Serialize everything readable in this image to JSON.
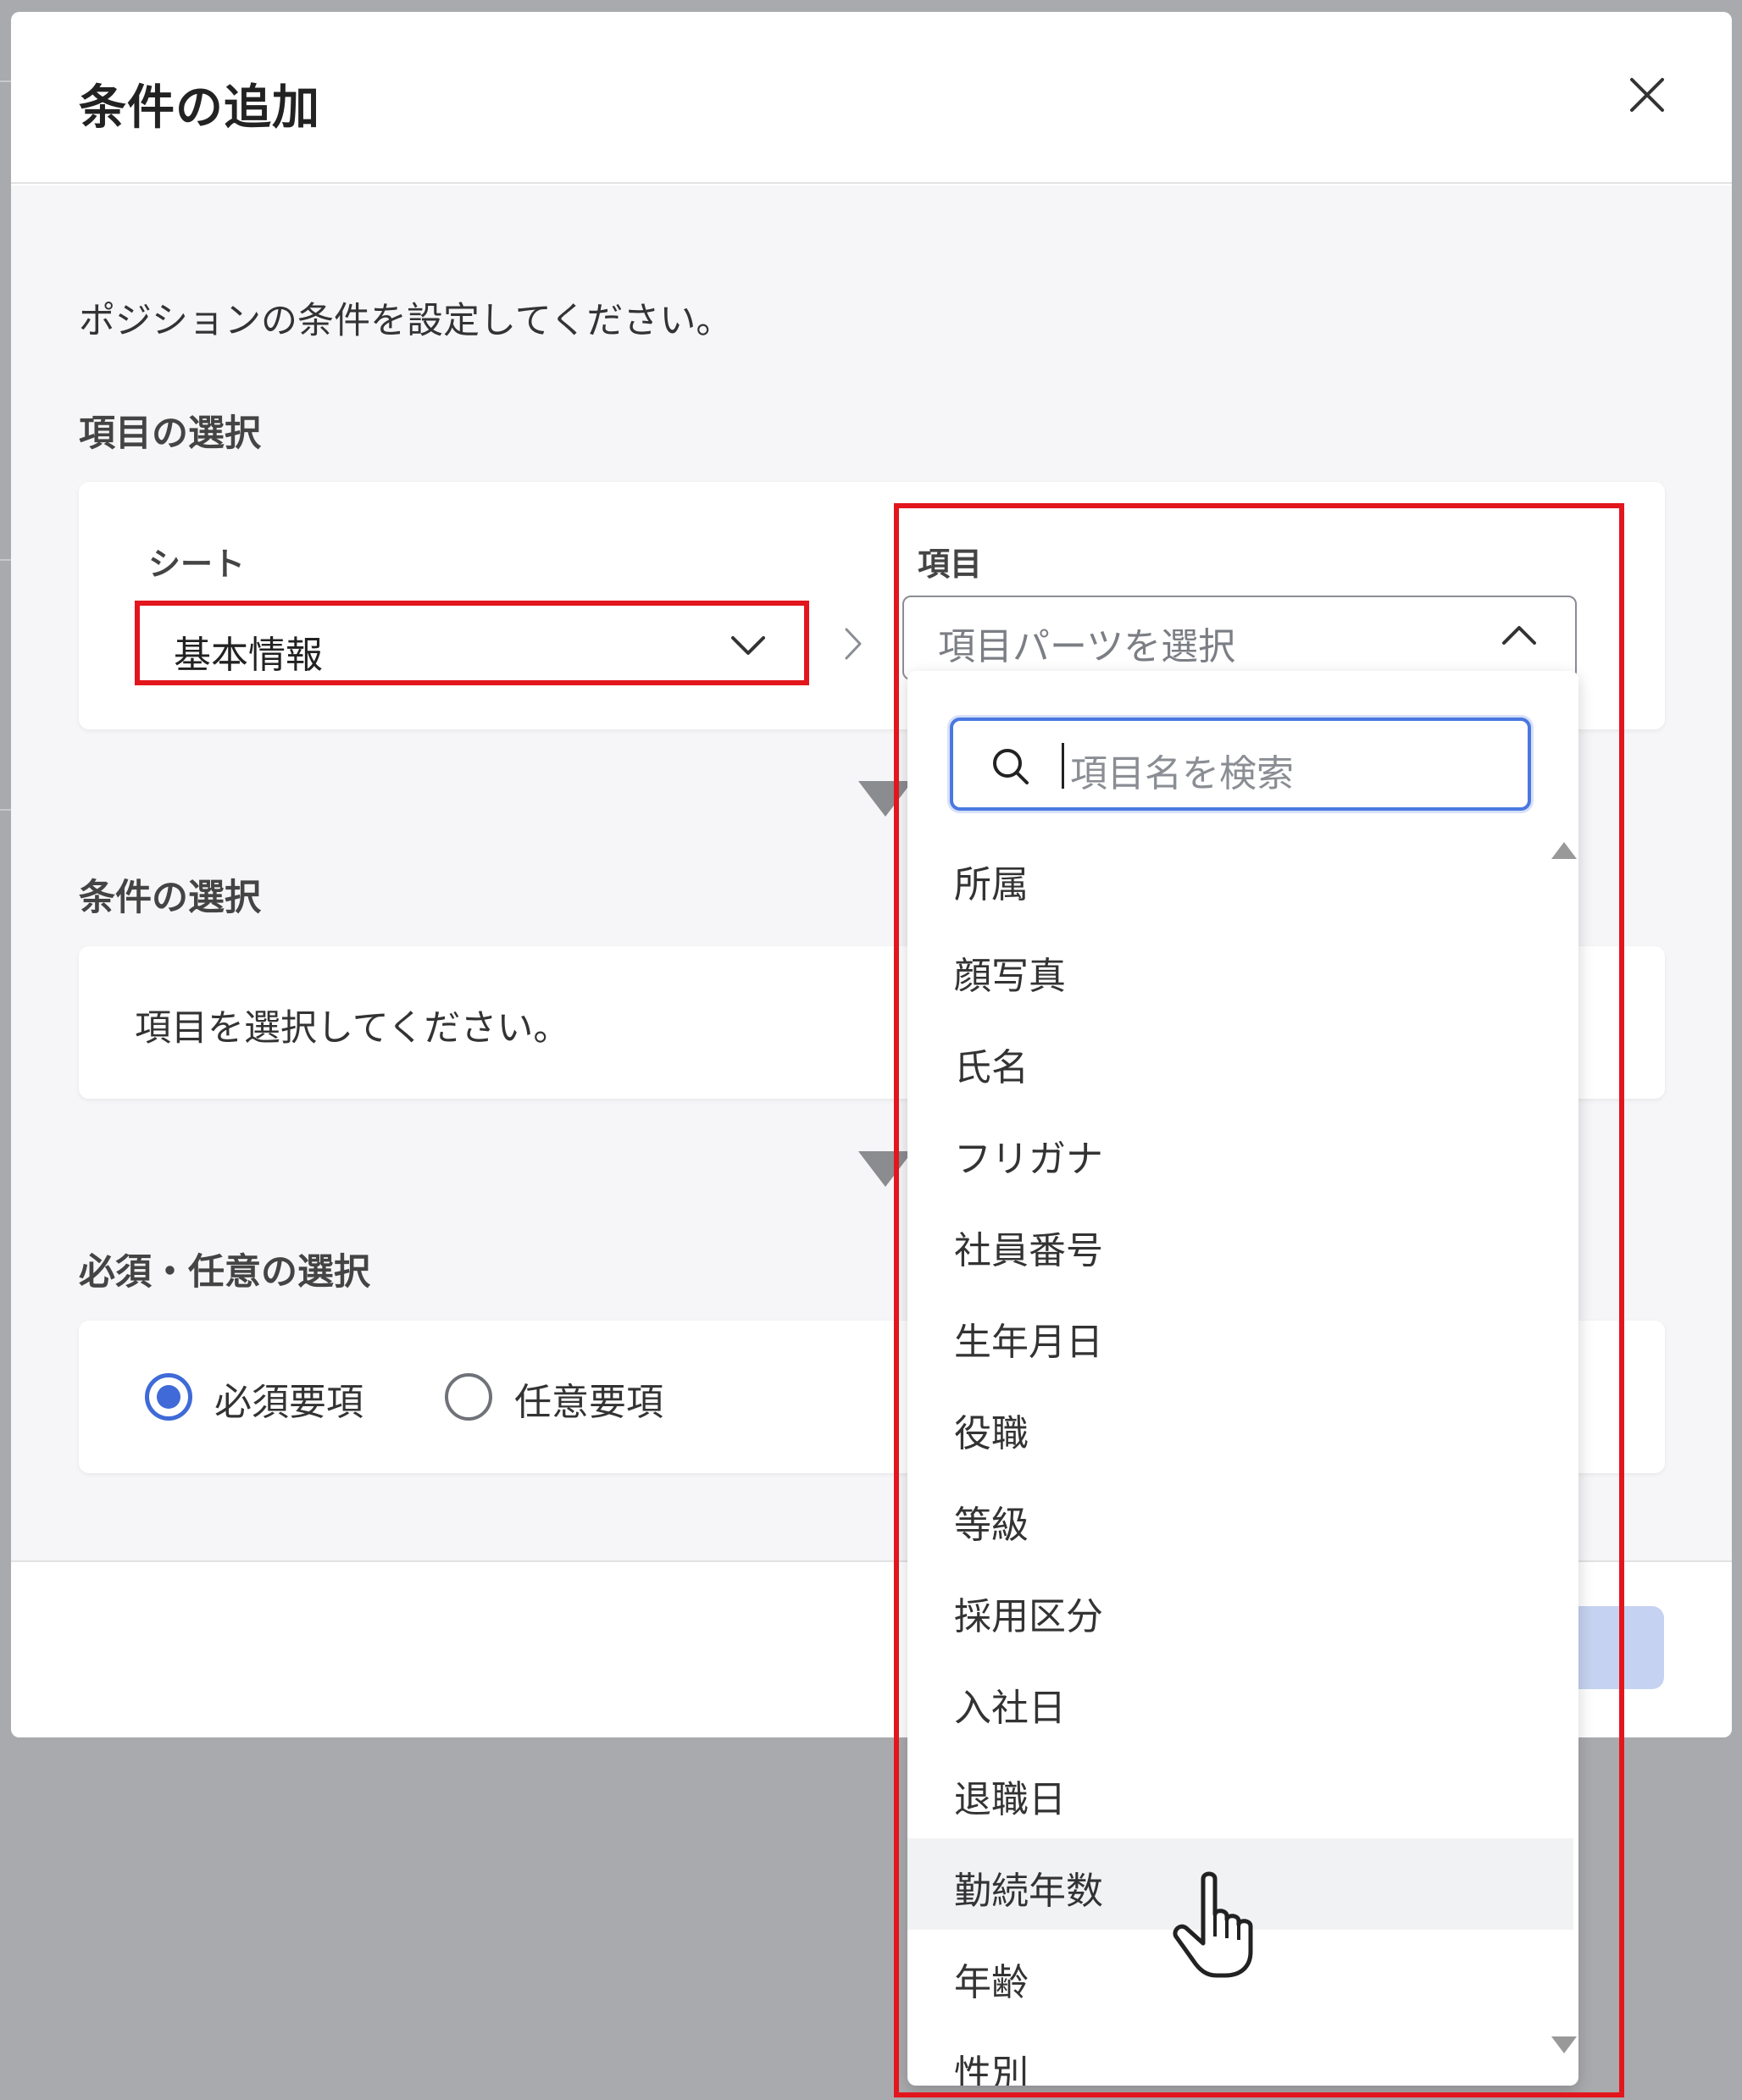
{
  "dialog": {
    "title": "条件の追加",
    "description": "ポジションの条件を設定してください。"
  },
  "item_selection": {
    "section_title": "項目の選択",
    "sheet_label": "シート",
    "sheet_value": "基本情報",
    "item_label": "項目",
    "item_placeholder": "項目パーツを選択"
  },
  "condition_selection": {
    "section_title": "条件の選択",
    "message": "項目を選択してください。"
  },
  "required_selection": {
    "section_title": "必須・任意の選択",
    "options": [
      {
        "label": "必須要項",
        "selected": true
      },
      {
        "label": "任意要項",
        "selected": false
      }
    ]
  },
  "dropdown": {
    "search_placeholder": "項目名を検索",
    "items": [
      "所属",
      "顔写真",
      "氏名",
      "フリガナ",
      "社員番号",
      "生年月日",
      "役職",
      "等級",
      "採用区分",
      "入社日",
      "退職日",
      "勤続年数",
      "年齢",
      "性別"
    ],
    "hovered_item": "勤続年数"
  },
  "colors": {
    "accent": "#3f6ad8",
    "highlight": "#e3161d",
    "primary_button_disabled": "#c6d2f1"
  }
}
